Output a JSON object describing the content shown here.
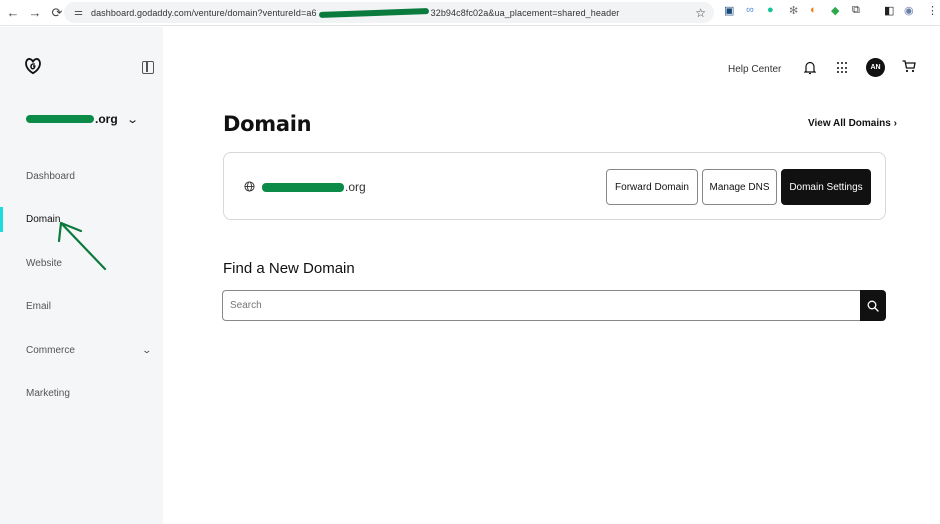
{
  "browser": {
    "url_prefix": "dashboard.godaddy.com/venture/domain?ventureId=a6",
    "url_suffix": "32b94c8fc02a&ua_placement=shared_header",
    "back": "←",
    "forward": "→",
    "reload": "⟳",
    "star": "☆",
    "menu": "⋮"
  },
  "sidebar": {
    "account_suffix": ".org",
    "items": [
      {
        "label": "Dashboard"
      },
      {
        "label": "Domain",
        "active": true
      },
      {
        "label": "Website"
      },
      {
        "label": "Email"
      },
      {
        "label": "Commerce",
        "has_submenu": true
      },
      {
        "label": "Marketing"
      }
    ]
  },
  "topbar": {
    "help": "Help Center",
    "avatar_initials": "AN"
  },
  "main": {
    "title": "Domain",
    "view_all": "View All Domains ›",
    "domain_suffix": ".org",
    "buttons": {
      "forward": "Forward Domain",
      "dns": "Manage DNS",
      "settings": "Domain Settings"
    },
    "find_title": "Find a New Domain",
    "search_placeholder": "Search"
  },
  "colors": {
    "active_indicator": "#1bdbdb",
    "primary_dark": "#111111",
    "annotation_green": "#0b7a3d"
  }
}
